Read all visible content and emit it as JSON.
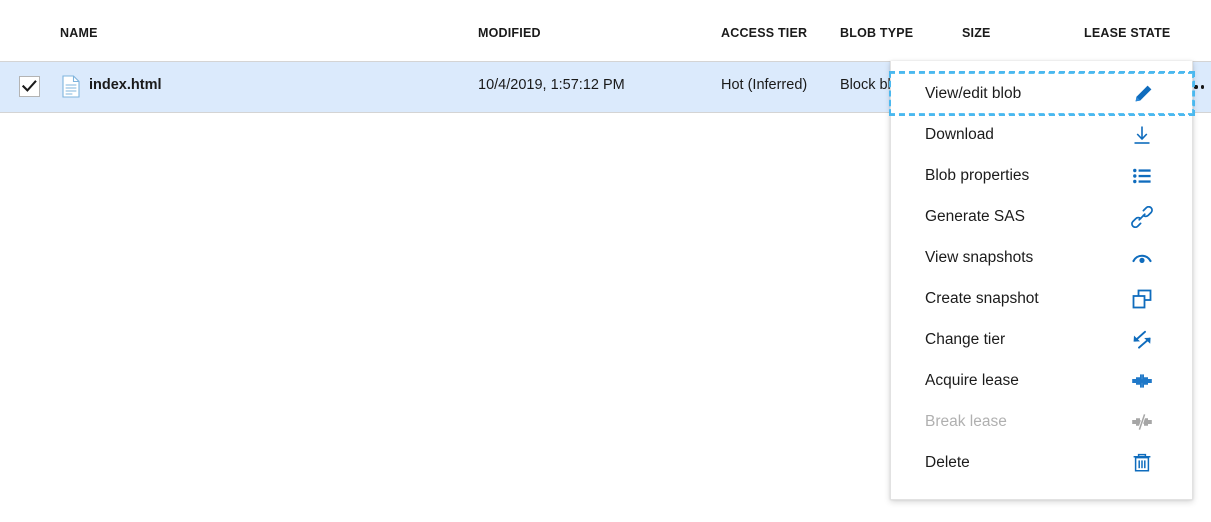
{
  "table": {
    "columns": [
      {
        "key": "name",
        "label": "NAME"
      },
      {
        "key": "modified",
        "label": "MODIFIED"
      },
      {
        "key": "access",
        "label": "ACCESS TIER"
      },
      {
        "key": "blobtype",
        "label": "BLOB TYPE"
      },
      {
        "key": "size",
        "label": "SIZE"
      },
      {
        "key": "lease",
        "label": "LEASE STATE"
      }
    ],
    "rows": [
      {
        "selected": true,
        "name": "index.html",
        "modified": "10/4/2019, 1:57:12 PM",
        "access": "Hot (Inferred)",
        "blobtype": "Block blob",
        "size": "",
        "lease": ""
      }
    ],
    "row_checkbox_icon": "check-icon",
    "row_file_icon": "file-document-icon",
    "row_more_icon": "ellipsis-icon"
  },
  "context_menu": {
    "items": [
      {
        "label": "View/edit blob",
        "icon": "pencil-icon",
        "disabled": false,
        "focused": true
      },
      {
        "label": "Download",
        "icon": "download-icon",
        "disabled": false,
        "focused": false
      },
      {
        "label": "Blob properties",
        "icon": "list-icon",
        "disabled": false,
        "focused": false
      },
      {
        "label": "Generate SAS",
        "icon": "link-icon",
        "disabled": false,
        "focused": false
      },
      {
        "label": "View snapshots",
        "icon": "eye-icon",
        "disabled": false,
        "focused": false
      },
      {
        "label": "Create snapshot",
        "icon": "copy-windows-icon",
        "disabled": false,
        "focused": false
      },
      {
        "label": "Change tier",
        "icon": "swap-arrows-icon",
        "disabled": false,
        "focused": false
      },
      {
        "label": "Acquire lease",
        "icon": "plug-connect-icon",
        "disabled": false,
        "focused": false
      },
      {
        "label": "Break lease",
        "icon": "plug-disconnect-icon",
        "disabled": true,
        "focused": false
      },
      {
        "label": "Delete",
        "icon": "trash-icon",
        "disabled": false,
        "focused": false
      }
    ]
  },
  "colors": {
    "accent": "#0f6cbd",
    "row_selected_bg": "#dbeafc",
    "focus_outline": "#4bb8ef",
    "disabled_text": "#b0b0b0"
  }
}
